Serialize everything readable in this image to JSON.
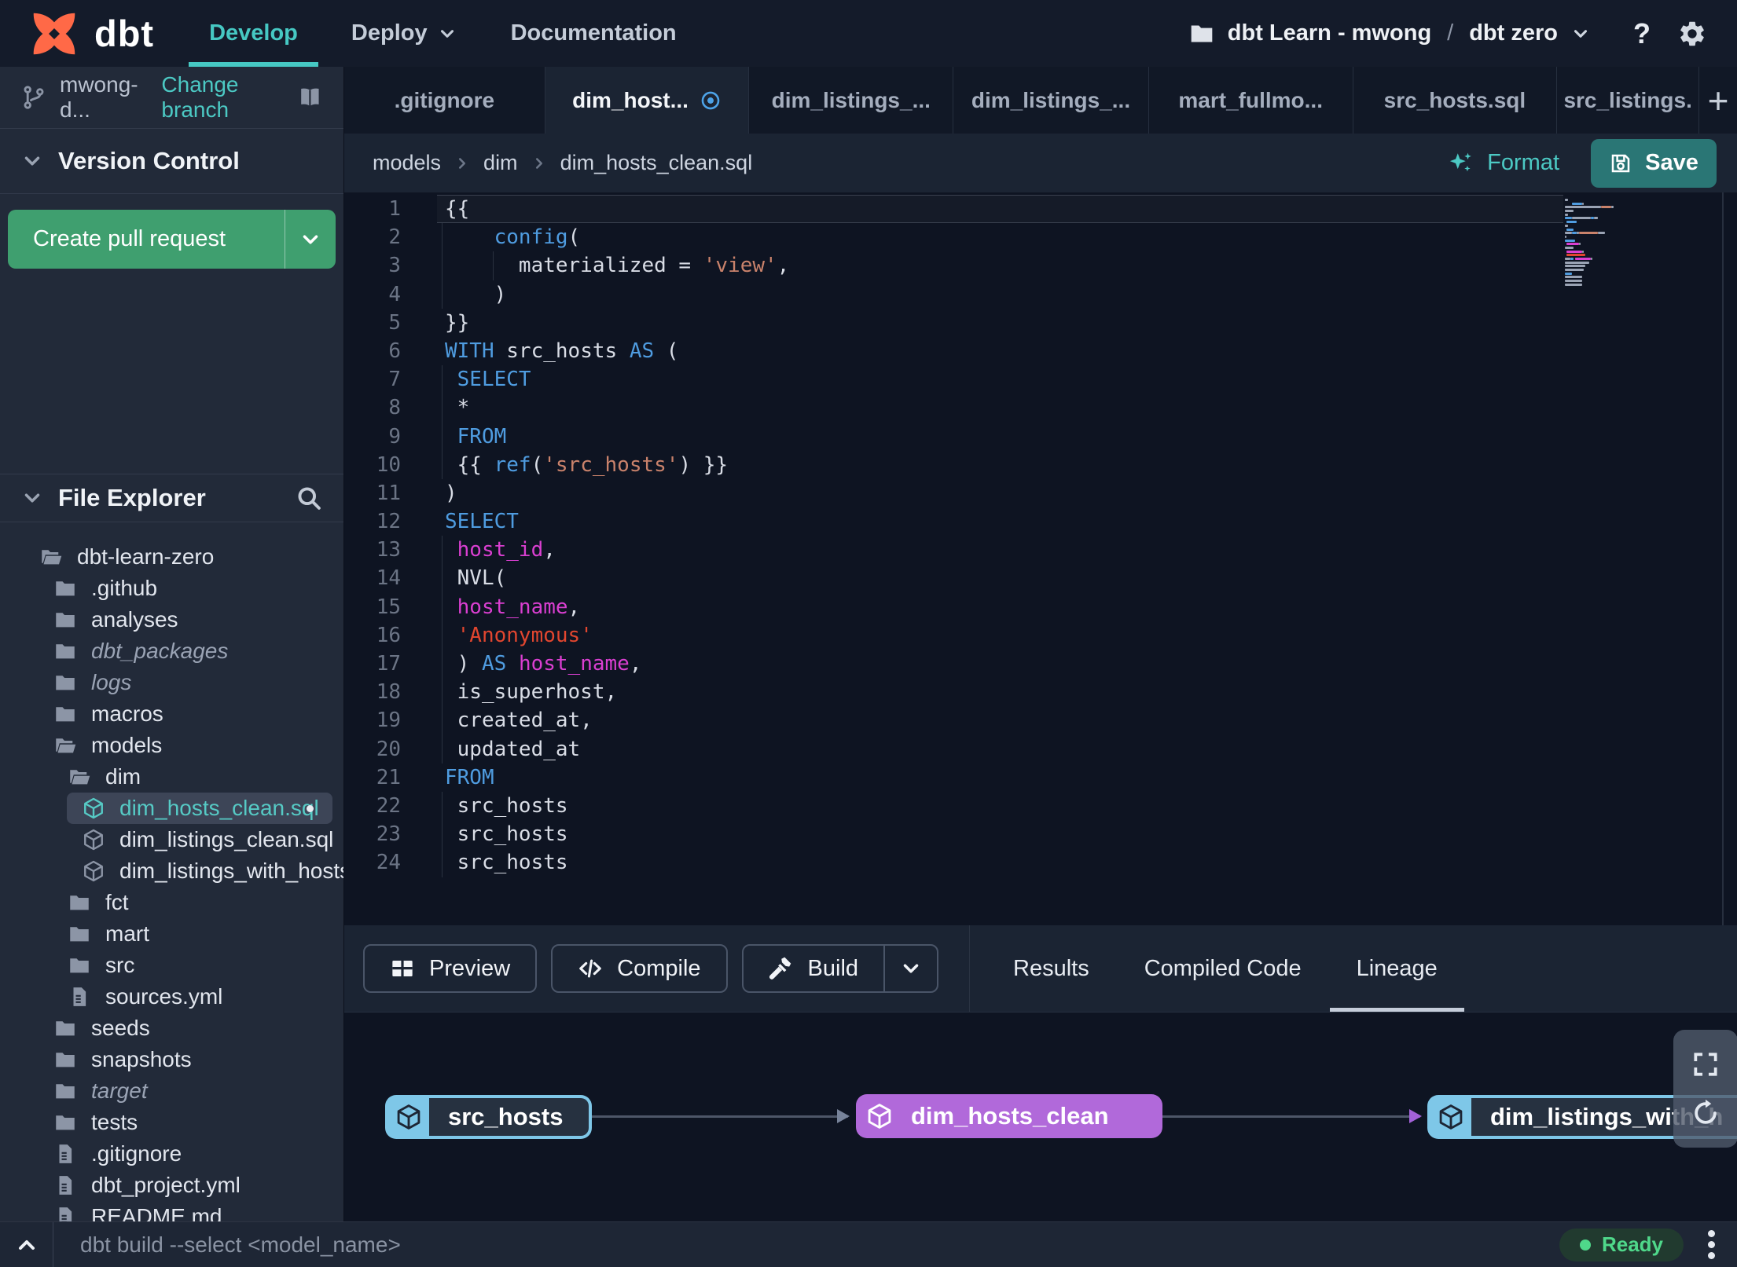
{
  "colors": {
    "accent_teal": "#46c8c3",
    "save_teal": "#2a7675",
    "pr_green": "#3f9f6f",
    "lineage_source_blue": "#7ec7e8",
    "lineage_model_purple": "#b169da",
    "ready_green": "#4fd88a",
    "unsaved_dot_blue": "#4da3e8",
    "dbt_orange": "#ff6947"
  },
  "navbar": {
    "brand": "dbt",
    "items": [
      {
        "label": "Develop",
        "active": true
      },
      {
        "label": "Deploy",
        "dropdown": true
      },
      {
        "label": "Documentation"
      }
    ],
    "project": {
      "account": "dbt Learn - mwong",
      "separator": "/",
      "environment": "dbt zero"
    },
    "help_icon": "?"
  },
  "sidebar": {
    "branch": {
      "name": "mwong-d...",
      "change_link": "Change branch"
    },
    "version_control": {
      "title": "Version Control",
      "create_pr_label": "Create pull request"
    },
    "file_explorer": {
      "title": "File Explorer",
      "tree": [
        {
          "label": "dbt-learn-zero",
          "depth": 0,
          "type": "folder-open"
        },
        {
          "label": ".github",
          "depth": 1,
          "type": "folder"
        },
        {
          "label": "analyses",
          "depth": 1,
          "type": "folder"
        },
        {
          "label": "dbt_packages",
          "depth": 1,
          "type": "folder",
          "italic": true
        },
        {
          "label": "logs",
          "depth": 1,
          "type": "folder",
          "italic": true
        },
        {
          "label": "macros",
          "depth": 1,
          "type": "folder"
        },
        {
          "label": "models",
          "depth": 1,
          "type": "folder-open"
        },
        {
          "label": "dim",
          "depth": 2,
          "type": "folder-open"
        },
        {
          "label": "dim_hosts_clean.sql",
          "depth": 3,
          "type": "model",
          "selected": true,
          "modified": true
        },
        {
          "label": "dim_listings_clean.sql",
          "depth": 3,
          "type": "model"
        },
        {
          "label": "dim_listings_with_hosts...",
          "depth": 3,
          "type": "model"
        },
        {
          "label": "fct",
          "depth": 2,
          "type": "folder"
        },
        {
          "label": "mart",
          "depth": 2,
          "type": "folder"
        },
        {
          "label": "src",
          "depth": 2,
          "type": "folder"
        },
        {
          "label": "sources.yml",
          "depth": 2,
          "type": "file"
        },
        {
          "label": "seeds",
          "depth": 1,
          "type": "folder"
        },
        {
          "label": "snapshots",
          "depth": 1,
          "type": "folder"
        },
        {
          "label": "target",
          "depth": 1,
          "type": "folder",
          "italic": true
        },
        {
          "label": "tests",
          "depth": 1,
          "type": "folder"
        },
        {
          "label": ".gitignore",
          "depth": 1,
          "type": "file"
        },
        {
          "label": "dbt_project.yml",
          "depth": 1,
          "type": "file"
        },
        {
          "label": "README.md",
          "depth": 1,
          "type": "file"
        }
      ]
    }
  },
  "editor": {
    "tabs": [
      {
        "label": ".gitignore"
      },
      {
        "label": "dim_host...",
        "active": true,
        "modified": true
      },
      {
        "label": "dim_listings_..."
      },
      {
        "label": "dim_listings_..."
      },
      {
        "label": "mart_fullmo..."
      },
      {
        "label": "src_hosts.sql"
      },
      {
        "label": "src_listings."
      }
    ],
    "add_tab_icon": "+",
    "breadcrumb": [
      "models",
      "dim",
      "dim_hosts_clean.sql"
    ],
    "format_label": "Format",
    "save_label": "Save",
    "code": {
      "lines": [
        {
          "n": 1,
          "current": true,
          "tokens": [
            [
              "p",
              "{{"
            ]
          ]
        },
        {
          "n": 2,
          "guides": [
            0
          ],
          "tokens": [
            [
              "p",
              "    "
            ],
            [
              "k",
              "config"
            ],
            [
              "p",
              "("
            ]
          ]
        },
        {
          "n": 3,
          "guides": [
            0,
            1
          ],
          "tokens": [
            [
              "p",
              "      materialized = "
            ],
            [
              "s",
              "'view'"
            ],
            [
              "p",
              ","
            ]
          ]
        },
        {
          "n": 4,
          "guides": [
            0
          ],
          "tokens": [
            [
              "p",
              "    )"
            ]
          ]
        },
        {
          "n": 5,
          "tokens": [
            [
              "p",
              "}}"
            ]
          ]
        },
        {
          "n": 6,
          "tokens": [
            [
              "k",
              "WITH"
            ],
            [
              "p",
              " src_hosts "
            ],
            [
              "k",
              "AS"
            ],
            [
              "p",
              " ("
            ]
          ]
        },
        {
          "n": 7,
          "guides": [
            0
          ],
          "tokens": [
            [
              "p",
              " "
            ],
            [
              "k",
              "SELECT"
            ]
          ]
        },
        {
          "n": 8,
          "guides": [
            0
          ],
          "tokens": [
            [
              "p",
              " *"
            ]
          ]
        },
        {
          "n": 9,
          "guides": [
            0
          ],
          "tokens": [
            [
              "p",
              " "
            ],
            [
              "k",
              "FROM"
            ]
          ]
        },
        {
          "n": 10,
          "guides": [
            0
          ],
          "tokens": [
            [
              "p",
              " {{ "
            ],
            [
              "k",
              "ref"
            ],
            [
              "p",
              "("
            ],
            [
              "s",
              "'src_hosts'"
            ],
            [
              "p",
              ") }}"
            ]
          ]
        },
        {
          "n": 11,
          "tokens": [
            [
              "p",
              ")"
            ]
          ]
        },
        {
          "n": 12,
          "tokens": [
            [
              "k",
              "SELECT"
            ]
          ]
        },
        {
          "n": 13,
          "guides": [
            0
          ],
          "tokens": [
            [
              "p",
              " "
            ],
            [
              "m",
              "host_id"
            ],
            [
              "p",
              ","
            ]
          ]
        },
        {
          "n": 14,
          "guides": [
            0
          ],
          "tokens": [
            [
              "p",
              " NVL("
            ]
          ]
        },
        {
          "n": 15,
          "guides": [
            0
          ],
          "tokens": [
            [
              "p",
              " "
            ],
            [
              "m",
              "host_name"
            ],
            [
              "p",
              ","
            ]
          ]
        },
        {
          "n": 16,
          "guides": [
            0
          ],
          "tokens": [
            [
              "p",
              " "
            ],
            [
              "r",
              "'Anonymous'"
            ]
          ]
        },
        {
          "n": 17,
          "guides": [
            0
          ],
          "tokens": [
            [
              "p",
              " ) "
            ],
            [
              "k",
              "AS"
            ],
            [
              "p",
              " "
            ],
            [
              "m",
              "host_name"
            ],
            [
              "p",
              ","
            ]
          ]
        },
        {
          "n": 18,
          "guides": [
            0
          ],
          "tokens": [
            [
              "p",
              " is_superhost,"
            ]
          ]
        },
        {
          "n": 19,
          "guides": [
            0
          ],
          "tokens": [
            [
              "p",
              " created_at,"
            ]
          ]
        },
        {
          "n": 20,
          "guides": [
            0
          ],
          "tokens": [
            [
              "p",
              " updated_at"
            ]
          ]
        },
        {
          "n": 21,
          "tokens": [
            [
              "k",
              "FROM"
            ]
          ]
        },
        {
          "n": 22,
          "guides": [
            0
          ],
          "tokens": [
            [
              "p",
              " src_hosts"
            ]
          ]
        },
        {
          "n": 23,
          "guides": [
            0
          ],
          "tokens": [
            [
              "p",
              " src_hosts"
            ]
          ]
        },
        {
          "n": 24,
          "guides": [
            0
          ],
          "tokens": [
            [
              "p",
              " src_hosts"
            ]
          ]
        }
      ]
    }
  },
  "bottom_panel": {
    "buttons": [
      {
        "label": "Preview",
        "icon": "table-icon"
      },
      {
        "label": "Compile",
        "icon": "code-icon"
      },
      {
        "label": "Build",
        "icon": "hammer-icon",
        "split": true
      }
    ],
    "tabs": [
      {
        "label": "Results"
      },
      {
        "label": "Compiled Code"
      },
      {
        "label": "Lineage",
        "active": true
      }
    ],
    "lineage": {
      "nodes": [
        {
          "label": "src_hosts",
          "kind": "source"
        },
        {
          "label": "dim_hosts_clean",
          "kind": "model-selected"
        },
        {
          "label": "dim_listings_with_h",
          "kind": "source"
        }
      ]
    }
  },
  "statusbar": {
    "command_placeholder": "dbt build --select <model_name>",
    "status": "Ready"
  }
}
